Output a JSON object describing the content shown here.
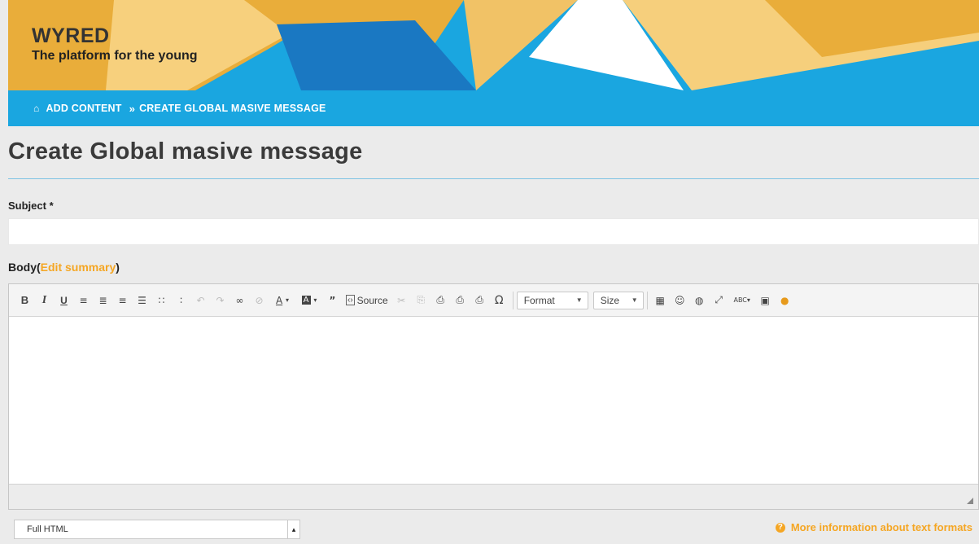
{
  "brand": {
    "name": "WYRED",
    "tagline": "The platform for the young"
  },
  "breadcrumb": {
    "home_icon": "home-icon",
    "items": [
      "ADD CONTENT",
      "CREATE GLOBAL MASIVE MESSAGE"
    ],
    "separator": "»"
  },
  "page": {
    "title": "Create Global masive message"
  },
  "subject": {
    "label": "Subject",
    "required_mark": "*",
    "value": ""
  },
  "body": {
    "label": "Body",
    "edit_summary_label": "Edit summary",
    "open_paren": "(",
    "close_paren": ")"
  },
  "toolbar": {
    "bold": "B",
    "italic": "I",
    "underline": "U",
    "source_label": "Source",
    "format_label": "Format",
    "size_label": "Size"
  },
  "text_format": {
    "selected": "Full HTML",
    "more_info_label": "More information about text formats"
  },
  "colors": {
    "header_blue": "#1aa6e0",
    "accent_orange": "#f5a623",
    "yellow_light": "#f7d07d"
  }
}
